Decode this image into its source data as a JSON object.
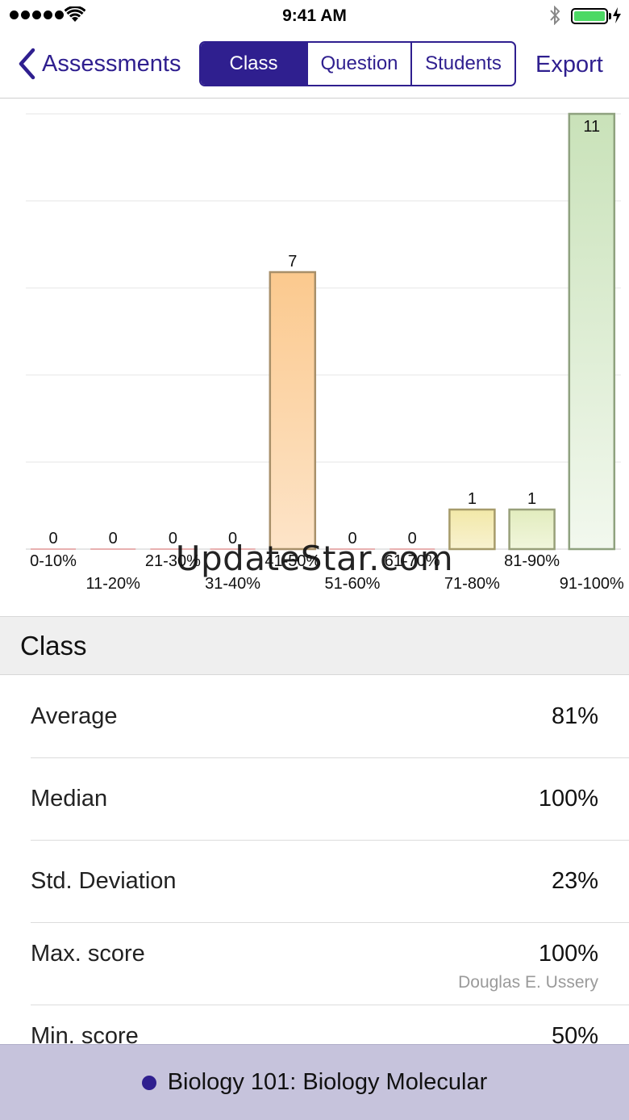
{
  "status_bar": {
    "time": "9:41 AM"
  },
  "nav": {
    "back_label": "Assessments",
    "segments": [
      "Class",
      "Question",
      "Students"
    ],
    "active_segment": "Class",
    "export_label": "Export"
  },
  "colors": {
    "accent": "#2f1f8f",
    "bar_orange": "#fbc98e",
    "bar_yellow": "#f2e8a8",
    "bar_green": "#c9e2b9",
    "bottom_bar": "#c6c3dc"
  },
  "chart_data": {
    "type": "bar",
    "categories": [
      "0-10%",
      "11-20%",
      "21-30%",
      "31-40%",
      "41-50%",
      "51-60%",
      "61-70%",
      "71-80%",
      "81-90%",
      "91-100%"
    ],
    "values": [
      0,
      0,
      0,
      0,
      7,
      0,
      0,
      1,
      1,
      11
    ],
    "ylim": [
      0,
      11
    ],
    "grid": true
  },
  "watermark": "UpdateStar.com",
  "section": {
    "title": "Class"
  },
  "stats": [
    {
      "label": "Average",
      "value": "81%"
    },
    {
      "label": "Median",
      "value": "100%"
    },
    {
      "label": "Std. Deviation",
      "value": "23%"
    },
    {
      "label": "Max. score",
      "value": "100%",
      "sub": "Douglas E. Ussery"
    },
    {
      "label": "Min. score",
      "value": "50%"
    }
  ],
  "bottom_bar": {
    "class_name": "Biology 101: Biology Molecular"
  }
}
